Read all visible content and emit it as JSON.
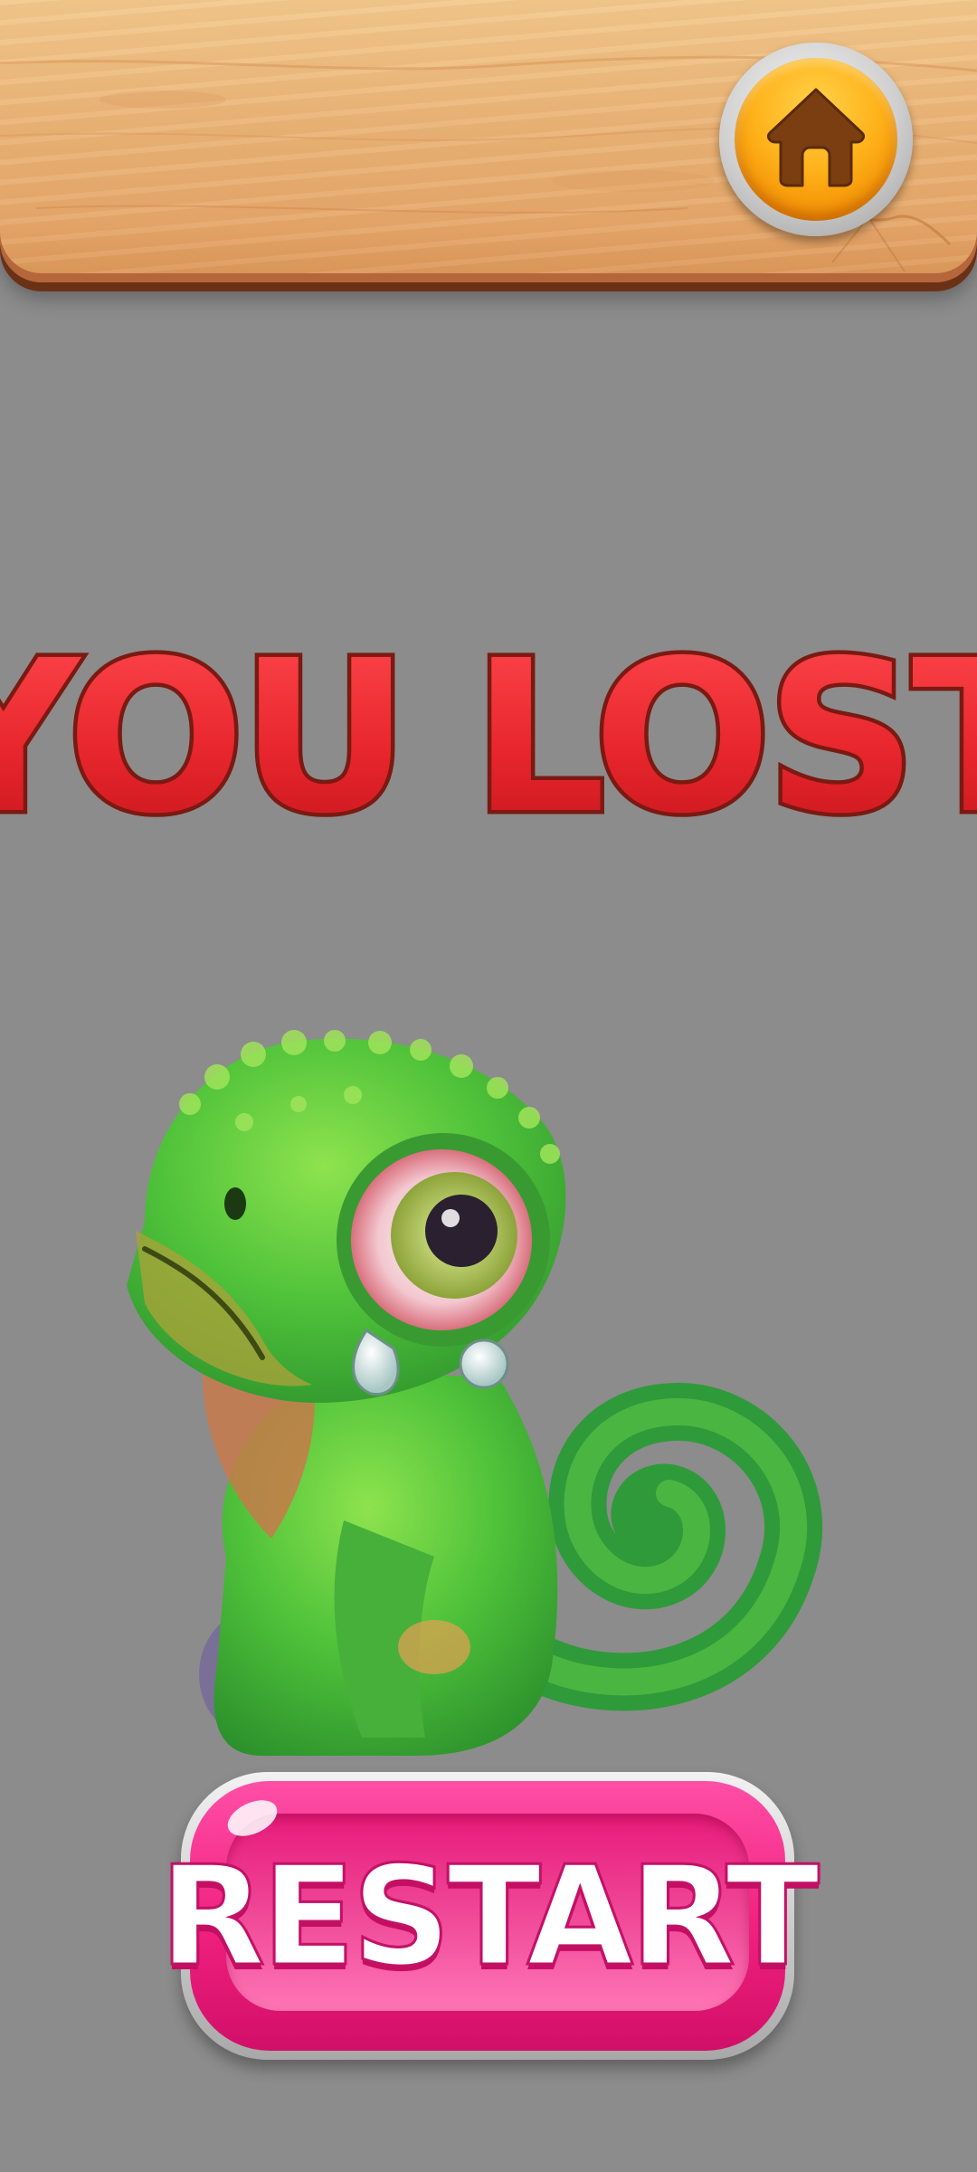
{
  "screen": {
    "background_color": "#8c8c8c"
  },
  "header": {
    "home_button": {
      "icon": "home-icon",
      "color": "#ffb21a"
    }
  },
  "result": {
    "title": "YOU LOST",
    "title_color": "#e8262d",
    "title_outline_color": "#7a1a12"
  },
  "character": {
    "name_icon": "sad-chameleon-illustration",
    "body_color": "#4fc23a"
  },
  "actions": {
    "restart_label": "RESTART",
    "restart_color": "#f0207f"
  }
}
